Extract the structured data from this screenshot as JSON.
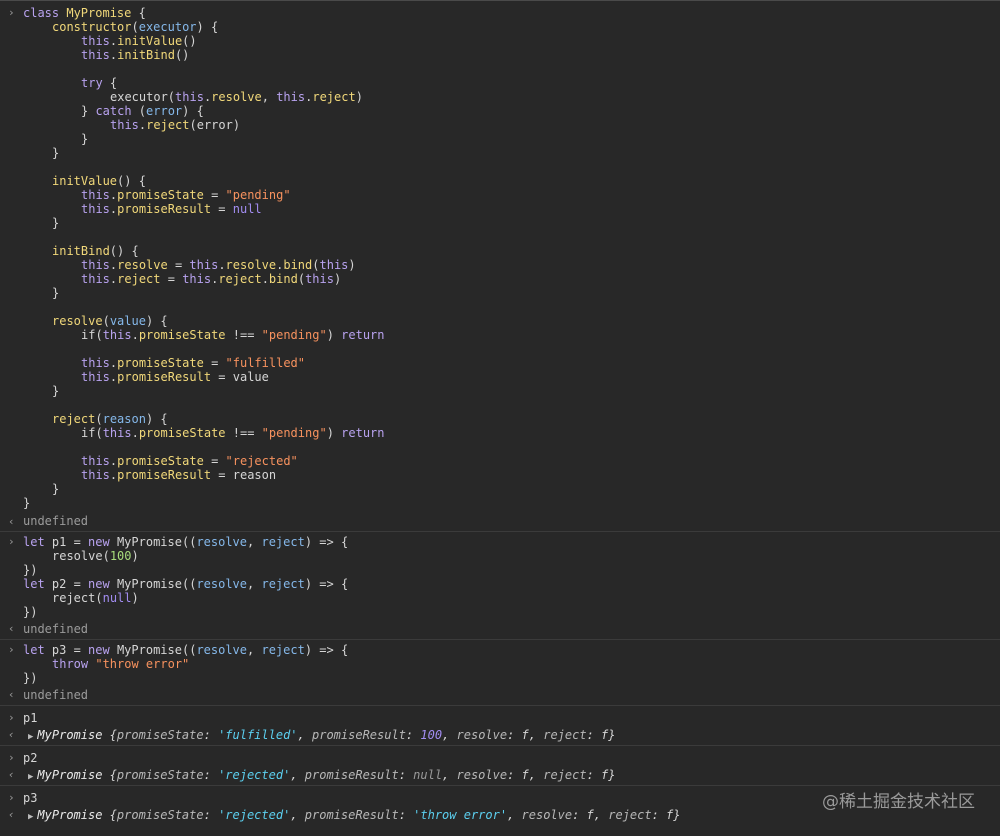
{
  "prompt_glyph": "›",
  "result_glyph": "‹",
  "undefined_text": "undefined",
  "input1": {
    "line1": {
      "kw": "class",
      "name": "MyPromise",
      "rest": " {"
    },
    "ctor": {
      "name": "constructor",
      "open": "(",
      "param": "executor",
      "close": ") {"
    },
    "ctor_init1": {
      "th": "this",
      "fn": "initValue",
      "rest": "()"
    },
    "ctor_init2": {
      "th": "this",
      "fn": "initBind",
      "rest": "()"
    },
    "try_open": {
      "kw": "try",
      "rest": " {"
    },
    "exec_call": {
      "pre": "executor(",
      "th1": "this",
      "dot1": ".",
      "fn1": "resolve",
      "mid": ", ",
      "th2": "this",
      "dot2": ".",
      "fn2": "reject",
      "end": ")"
    },
    "catch_line": {
      "pre": "} ",
      "kw": "catch",
      "open": " (",
      "param": "error",
      "close": ") {"
    },
    "reject_err": {
      "th": "this",
      "fn": "reject",
      "rest": "(error)"
    },
    "close_brace": "}",
    "initvalue": {
      "name": "initValue",
      "rest": "() {"
    },
    "iv_state": {
      "th": "this",
      "fn": "promiseState",
      "eq": " = ",
      "val": "\"pending\""
    },
    "iv_result": {
      "th": "this",
      "fn": "promiseResult",
      "eq": " = ",
      "val": "null"
    },
    "initbind": {
      "name": "initBind",
      "rest": "() {"
    },
    "ib_resolve": {
      "th": "this",
      "fn": "resolve",
      "eq": " = ",
      "th2": "this",
      "fn2": "resolve",
      "fn3": "bind",
      "open": "(",
      "th3": "this",
      "close": ")"
    },
    "ib_reject": {
      "th": "this",
      "fn": "reject",
      "eq": " = ",
      "th2": "this",
      "fn2": "reject",
      "fn3": "bind",
      "open": "(",
      "th3": "this",
      "close": ")"
    },
    "resolve": {
      "name": "resolve",
      "open": "(",
      "param": "value",
      "close": ") {"
    },
    "rs_if": {
      "pre": "if(",
      "th": "this",
      "fn": "promiseState",
      "op": " !== ",
      "str": "\"pending\"",
      "cl": ") ",
      "kw": "return"
    },
    "rs_state": {
      "th": "this",
      "fn": "promiseState",
      "eq": " = ",
      "val": "\"fulfilled\""
    },
    "rs_result": {
      "th": "this",
      "fn": "promiseResult",
      "eq": " = ",
      "val": "value"
    },
    "reject": {
      "name": "reject",
      "open": "(",
      "param": "reason",
      "close": ") {"
    },
    "rj_if": {
      "pre": "if(",
      "th": "this",
      "fn": "promiseState",
      "op": " !== ",
      "str": "\"pending\"",
      "cl": ") ",
      "kw": "return"
    },
    "rj_state": {
      "th": "this",
      "fn": "promiseState",
      "eq": " = ",
      "val": "\"rejected\""
    },
    "rj_result": {
      "th": "this",
      "fn": "promiseResult",
      "eq": " = ",
      "val": "reason"
    }
  },
  "input2": {
    "p1_decl": {
      "kw": "let",
      "var": " p1 = ",
      "kw2": "new",
      "cls": " MyPromise",
      "open": "((",
      "prm1": "resolve",
      "sep": ", ",
      "prm2": "reject",
      "arrow": ") => {"
    },
    "p1_body": {
      "fn": "resolve",
      "open": "(",
      "num": "100",
      "close": ")"
    },
    "p_close": "})",
    "p2_decl": {
      "kw": "let",
      "var": " p2 = ",
      "kw2": "new",
      "cls": " MyPromise",
      "open": "((",
      "prm1": "resolve",
      "sep": ", ",
      "prm2": "reject",
      "arrow": ") => {"
    },
    "p2_body": {
      "fn": "reject",
      "open": "(",
      "nul": "null",
      "close": ")"
    }
  },
  "input3": {
    "p3_decl": {
      "kw": "let",
      "var": " p3 = ",
      "kw2": "new",
      "cls": " MyPromise",
      "open": "((",
      "prm1": "resolve",
      "sep": ", ",
      "prm2": "reject",
      "arrow": ") => {"
    },
    "p3_body": {
      "kw": "throw",
      "str": " \"throw error\""
    }
  },
  "evals": [
    {
      "input": "p1",
      "name": "MyPromise",
      "state_key": "promiseState",
      "state_val": "'fulfilled'",
      "result_key": "promiseResult",
      "result_val": "100",
      "resolve_key": "resolve",
      "resolve_val": "f",
      "reject_key": "reject",
      "reject_val": "f"
    },
    {
      "input": "p2",
      "name": "MyPromise",
      "state_key": "promiseState",
      "state_val": "'rejected'",
      "result_key": "promiseResult",
      "result_val": "null",
      "resolve_key": "resolve",
      "resolve_val": "f",
      "reject_key": "reject",
      "reject_val": "f"
    },
    {
      "input": "p3",
      "name": "MyPromise",
      "state_key": "promiseState",
      "state_val": "'rejected'",
      "result_key": "promiseResult",
      "result_val": "'throw error'",
      "resolve_key": "resolve",
      "resolve_val": "f",
      "reject_key": "reject",
      "reject_val": "f"
    }
  ],
  "watermark": "@稀土掘金技术社区"
}
